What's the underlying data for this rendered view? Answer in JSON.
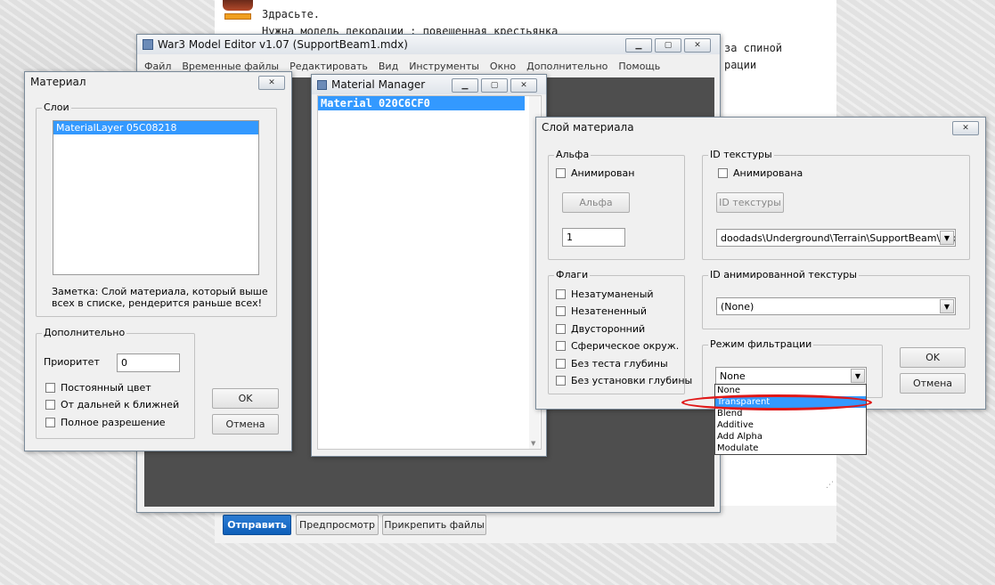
{
  "forum": {
    "lines": [
      "Здрасьте.",
      "Нужна модель декорации : повешенная крестьянка",
      "за спиной",
      "рации"
    ],
    "buttons": {
      "send": "Отправить",
      "preview": "Предпросмотр",
      "attach": "Прикрепить файлы"
    }
  },
  "editor": {
    "title": "War3 Model Editor v1.07 (SupportBeam1.mdx)",
    "menu": [
      "Файл",
      "Временные файлы",
      "Редактировать",
      "Вид",
      "Инструменты",
      "Окно",
      "Дополнительно",
      "Помощь"
    ]
  },
  "material_dialog": {
    "title": "Материал",
    "layers_label": "Слои",
    "layers": [
      "MaterialLayer 05C08218"
    ],
    "note": [
      "Заметка: Слой материала, который выше",
      "всех в списке, рендерится раньше всех!"
    ],
    "extra_label": "Дополнительно",
    "priority_label": "Приоритет",
    "priority_value": "0",
    "checkboxes": [
      "Постоянный цвет",
      "От дальней к ближней",
      "Полное разрешение"
    ],
    "ok": "OK",
    "cancel": "Отмена"
  },
  "material_manager": {
    "title": "Material Manager",
    "items": [
      "Material 020C6CF0"
    ]
  },
  "layer_dialog": {
    "title": "Слой материала",
    "alpha": {
      "label": "Альфа",
      "animated": "Анимирован",
      "button": "Альфа",
      "value": "1"
    },
    "texture": {
      "label": "ID текстуры",
      "animated": "Анимирована",
      "button": "ID текстуры",
      "path": "doodads\\Underground\\Terrain\\SupportBeam\\Suppo"
    },
    "flags": {
      "label": "Флаги",
      "items": [
        "Незатуманеный",
        "Незатененный",
        "Двусторонний",
        "Сферическое окруж.",
        "Без теста глубины",
        "Без установки глубины"
      ]
    },
    "anim_texture": {
      "label": "ID анимированной текстуры",
      "value": "(None)"
    },
    "filter": {
      "label": "Режим фильтрации",
      "value": "None",
      "options": [
        "None",
        "Transparent",
        "Blend",
        "Additive",
        "Add Alpha",
        "Modulate"
      ],
      "highlighted": "Transparent"
    },
    "ok": "OK",
    "cancel": "Отмена"
  },
  "colors": {
    "selection": "#3399ff",
    "annotation": "#e01818",
    "primary_button": "#0d5eb8"
  }
}
